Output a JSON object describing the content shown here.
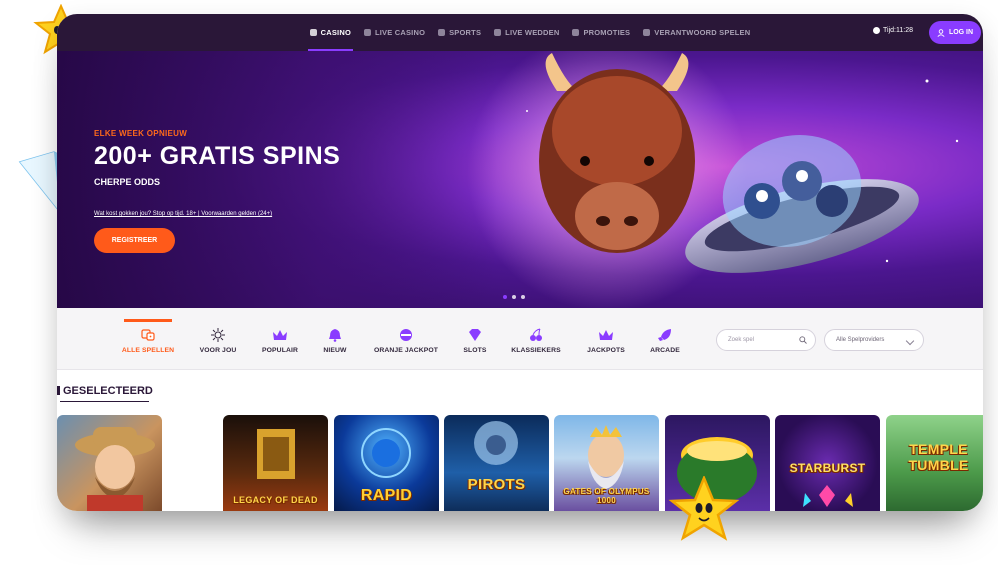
{
  "nav": {
    "items": [
      {
        "label": "CASINO",
        "active": true,
        "icon": "casino-icon"
      },
      {
        "label": "LIVE CASINO",
        "active": false,
        "icon": "live-casino-icon"
      },
      {
        "label": "SPORTS",
        "active": false,
        "icon": "sports-icon"
      },
      {
        "label": "LIVE WEDDEN",
        "active": false,
        "icon": "live-betting-icon"
      },
      {
        "label": "PROMOTIES",
        "active": false,
        "icon": "gift-icon"
      },
      {
        "label": "VERANTWOORD SPELEN",
        "active": false,
        "icon": "shield-icon"
      }
    ],
    "time": "Tijd:11:28",
    "login_label": "LOG IN"
  },
  "hero": {
    "eyebrow": "ELKE WEEK OPNIEUW",
    "title": "200+ GRATIS SPINS",
    "subtitle": "CHERPE ODDS",
    "legal": "Wat kost gokken jou? Stop op tijd. 18+ | Voorwaarden gelden (24+)",
    "cta": "REGISTREER"
  },
  "categories": [
    {
      "label": "ALLE SPELLEN",
      "active": true,
      "icon": "dice-icon"
    },
    {
      "label": "VOOR JOU",
      "active": false,
      "icon": "spark-icon"
    },
    {
      "label": "POPULAIR",
      "active": false,
      "icon": "crown-icon"
    },
    {
      "label": "NIEUW",
      "active": false,
      "icon": "bell-icon"
    },
    {
      "label": "ORANJE JACKPOT",
      "active": false,
      "icon": "jackpot-icon"
    },
    {
      "label": "SLOTS",
      "active": false,
      "icon": "gem-icon"
    },
    {
      "label": "KLASSIEKERS",
      "active": false,
      "icon": "cherry-icon"
    },
    {
      "label": "JACKPOTS",
      "active": false,
      "icon": "crown-outline-icon"
    },
    {
      "label": "ARCADE",
      "active": false,
      "icon": "rocket-icon"
    }
  ],
  "search": {
    "placeholder": "Zoek spel"
  },
  "providers": {
    "value": "Alle Spelproviders"
  },
  "section_title": "GESELECTEERD",
  "games": [
    {
      "title": "",
      "icon": "cowboy-game"
    },
    {
      "title": "LEGACY OF DEAD",
      "icon": "legacy-of-dead-game"
    },
    {
      "title": "RAPID",
      "icon": "rapid-game"
    },
    {
      "title": "PIROTS",
      "icon": "pirots-game"
    },
    {
      "title": "GATES OF OLYMPUS 1000",
      "icon": "gates-of-olympus-game"
    },
    {
      "title": "",
      "icon": "gold-pot-game"
    },
    {
      "title": "STARBURST",
      "icon": "starburst-game"
    },
    {
      "title": "TEMPLE TUMBLE",
      "icon": "temple-tumble-game"
    }
  ],
  "colors": {
    "accent": "#8a3cff",
    "brand_orange": "#ff5a1a",
    "nav_bg": "#2a1738"
  }
}
